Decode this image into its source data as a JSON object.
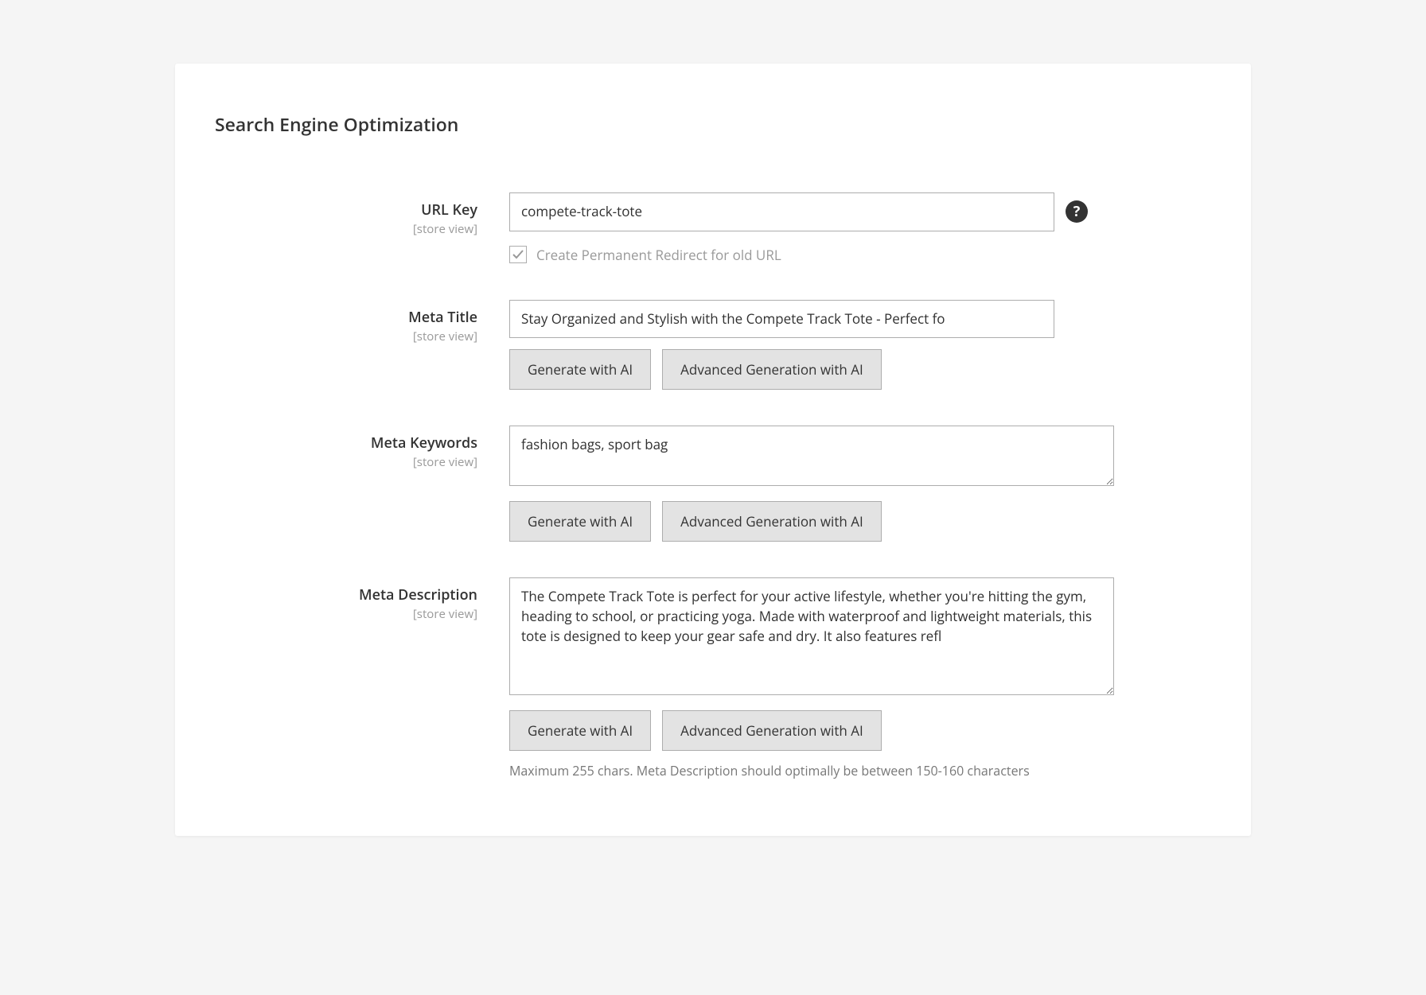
{
  "panel": {
    "title": "Search Engine Optimization"
  },
  "fields": {
    "url_key": {
      "label": "URL Key",
      "scope": "[store view]",
      "value": "compete-track-tote",
      "checkbox_label": "Create Permanent Redirect for old URL"
    },
    "meta_title": {
      "label": "Meta Title",
      "scope": "[store view]",
      "value": "Stay Organized and Stylish with the Compete Track Tote - Perfect fo"
    },
    "meta_keywords": {
      "label": "Meta Keywords",
      "scope": "[store view]",
      "value": "fashion bags, sport bag"
    },
    "meta_description": {
      "label": "Meta Description",
      "scope": "[store view]",
      "value": "The Compete Track Tote is perfect for your active lifestyle, whether you're hitting the gym, heading to school, or practicing yoga. Made with waterproof and lightweight materials, this tote is designed to keep your gear safe and dry. It also features refl",
      "note": "Maximum 255 chars. Meta Description should optimally be between 150-160 characters"
    }
  },
  "buttons": {
    "generate": "Generate with AI",
    "advanced": "Advanced Generation with AI"
  },
  "icons": {
    "help": "?"
  }
}
